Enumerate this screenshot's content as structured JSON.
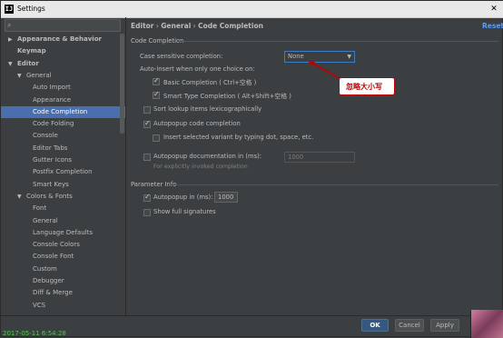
{
  "window": {
    "title": "Settings",
    "app_icon": "IJ"
  },
  "search": {
    "placeholder": ""
  },
  "tree": [
    {
      "label": "Appearance & Behavior",
      "arrow": "▶",
      "bold": true
    },
    {
      "label": "Keymap",
      "arrow": "",
      "bold": true
    },
    {
      "label": "Editor",
      "arrow": "▼",
      "bold": true
    },
    {
      "label": "General",
      "arrow": "▼",
      "bold": false
    },
    {
      "label": "Auto Import",
      "arrow": "",
      "bold": false
    },
    {
      "label": "Appearance",
      "arrow": "",
      "bold": false
    },
    {
      "label": "Code Completion",
      "arrow": "",
      "bold": false,
      "selected": true
    },
    {
      "label": "Code Folding",
      "arrow": "",
      "bold": false
    },
    {
      "label": "Console",
      "arrow": "",
      "bold": false
    },
    {
      "label": "Editor Tabs",
      "arrow": "",
      "bold": false
    },
    {
      "label": "Gutter Icons",
      "arrow": "",
      "bold": false
    },
    {
      "label": "Postfix Completion",
      "arrow": "",
      "bold": false
    },
    {
      "label": "Smart Keys",
      "arrow": "",
      "bold": false
    },
    {
      "label": "Colors & Fonts",
      "arrow": "▼",
      "bold": false
    },
    {
      "label": "Font",
      "arrow": "",
      "bold": false
    },
    {
      "label": "General",
      "arrow": "",
      "bold": false
    },
    {
      "label": "Language Defaults",
      "arrow": "",
      "bold": false
    },
    {
      "label": "Console Colors",
      "arrow": "",
      "bold": false
    },
    {
      "label": "Console Font",
      "arrow": "",
      "bold": false
    },
    {
      "label": "Custom",
      "arrow": "",
      "bold": false
    },
    {
      "label": "Debugger",
      "arrow": "",
      "bold": false
    },
    {
      "label": "Diff & Merge",
      "arrow": "",
      "bold": false
    },
    {
      "label": "VCS",
      "arrow": "",
      "bold": false
    }
  ],
  "breadcrumb": {
    "part1": "Editor",
    "sep": "›",
    "part2": "General",
    "part3": "Code Completion"
  },
  "reset_label": "Reset",
  "code_completion": {
    "section_label": "Code Completion",
    "case_sensitive_label": "Case sensitive completion:",
    "case_sensitive_value": "None",
    "auto_insert_label": "Auto-insert when only one choice on:",
    "basic_completion": "Basic Completion ( Ctrl+空格 )",
    "smart_type_completion": "Smart Type Completion ( Alt+Shift+空格 )",
    "sort_lookup": "Sort lookup items lexicographically",
    "autopopup_code": "Autopopup code completion",
    "insert_selected": "Insert selected variant by typing dot, space, etc.",
    "autopopup_doc": "Autopopup documentation in (ms):",
    "autopopup_doc_value": "1000",
    "explicit_hint": "For explicitly invoked completion"
  },
  "parameter_info": {
    "section_label": "Parameter Info",
    "autopopup_label": "Autopopup in (ms):",
    "autopopup_value": "1000",
    "show_full": "Show full signatures"
  },
  "checkboxes": {
    "basic_completion": true,
    "smart_type_completion": true,
    "sort_lookup": false,
    "autopopup_code": true,
    "insert_selected": false,
    "autopopup_doc": false,
    "param_autopopup": true,
    "show_full": false
  },
  "callout": {
    "text": "忽略大小写"
  },
  "buttons": {
    "ok": "OK",
    "cancel": "Cancel",
    "apply": "Apply"
  },
  "timestamp": "2017-05-11 6:54:28",
  "colors": {
    "accent": "#4b6eaf",
    "callout": "#c00000",
    "link": "#589df6"
  }
}
